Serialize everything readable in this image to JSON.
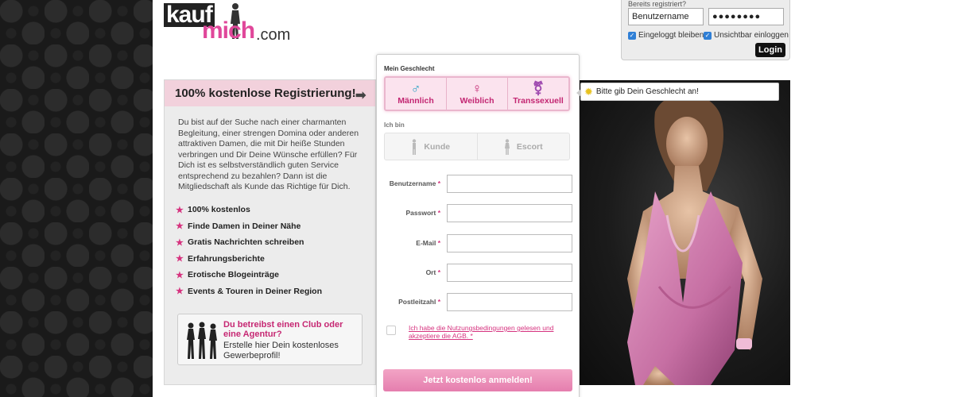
{
  "logo": {
    "part1": "kauf",
    "part2": "mich",
    "part3": ".com"
  },
  "login": {
    "heading": "Bereits registriert?",
    "username_value": "Benutzername",
    "password_value": "●●●●●●●●",
    "remember_label": "Eingeloggt bleiben",
    "invisible_label": "Unsichtbar einloggen",
    "button": "Login"
  },
  "promo": {
    "title": "100% kostenlose Registrierung!",
    "description": "Du bist auf der Suche nach einer charmanten Begleitung, einer strengen Domina oder anderen attraktiven Damen, die mit Dir heiße Stunden verbringen und Dir Deine Wünsche erfüllen? Für Dich ist es selbstverständlich guten Service entsprechend zu bezahlen? Dann ist die Mitgliedschaft als Kunde das Richtige für Dich.",
    "features": [
      "100% kostenlos",
      "Finde Damen in Deiner Nähe",
      "Gratis Nachrichten schreiben",
      "Erfahrungsberichte",
      "Erotische Blogeinträge",
      "Events & Touren in Deiner Region"
    ],
    "club_title": "Du betreibst einen Club oder eine Agentur?",
    "club_text": "Erstelle hier Dein kostenloses Gewerbeprofil!"
  },
  "form": {
    "gender_heading": "Mein Geschlecht",
    "genders": [
      {
        "label": "Männlich",
        "symbol": "♂",
        "color": "#2aa3c4"
      },
      {
        "label": "Weiblich",
        "symbol": "♀",
        "color": "#c32672"
      },
      {
        "label": "Transsexuell",
        "symbol": "⚧",
        "color": "#a04bb0"
      }
    ],
    "role_heading": "Ich bin",
    "roles": [
      "Kunde",
      "Escort"
    ],
    "fields": [
      "Benutzername",
      "Passwort",
      "E-Mail",
      "Ort",
      "Postleitzahl"
    ],
    "required_mark": "*",
    "terms": "Ich habe die Nutzungsbedingungen gelesen und akzeptiere die AGB. *",
    "submit": "Jetzt kostenlos anmelden!"
  },
  "tooltip": "Bitte gib Dein Geschlecht an!",
  "colors": {
    "accent": "#d6337f",
    "header_pink": "#f2d1dc",
    "submit": "#e98db7"
  }
}
